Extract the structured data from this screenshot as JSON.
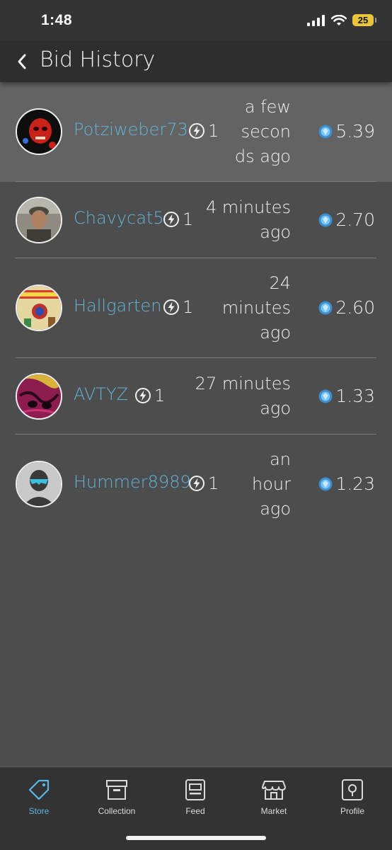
{
  "status_bar": {
    "time": "1:48",
    "battery": "25"
  },
  "header": {
    "title": "Bid History"
  },
  "bids": [
    {
      "username": "Potziweber73",
      "bolts": "1",
      "time": "a few\nsecon\nds ago",
      "price": "5.39"
    },
    {
      "username": "Chavycat5",
      "bolts": "1",
      "time": "4 minutes\nago",
      "price": "2.70"
    },
    {
      "username": "Hallgarten",
      "bolts": "1",
      "time": "24\nminutes\nago",
      "price": "2.60"
    },
    {
      "username": "AVTYZ",
      "bolts": "1",
      "time": "27 minutes\nago",
      "price": "1.33"
    },
    {
      "username": "Hummer8989",
      "bolts": "1",
      "time": "an\nhour\nago",
      "price": "1.23"
    }
  ],
  "tabs": [
    {
      "label": "Store",
      "icon": "tag-icon"
    },
    {
      "label": "Collection",
      "icon": "archive-box-icon"
    },
    {
      "label": "Feed",
      "icon": "feed-card-icon"
    },
    {
      "label": "Market",
      "icon": "storefront-icon"
    },
    {
      "label": "Profile",
      "icon": "profile-pin-icon"
    }
  ],
  "colors": {
    "accent": "#5cb6e3",
    "username": "#62b3d9",
    "highlight_row": "#636363",
    "background": "#4d4d4d"
  }
}
